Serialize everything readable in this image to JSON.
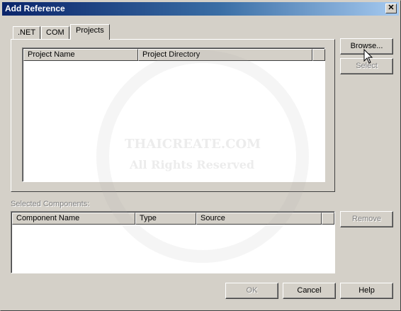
{
  "window": {
    "title": "Add Reference",
    "close_glyph": "✕"
  },
  "tabs": [
    {
      "label": ".NET"
    },
    {
      "label": "COM"
    },
    {
      "label": "Projects",
      "selected": true
    }
  ],
  "projects_list": {
    "columns": [
      "Project Name",
      "Project Directory"
    ],
    "rows": []
  },
  "side_buttons": {
    "browse": "Browse...",
    "select": "Select"
  },
  "selected_components": {
    "label": "Selected Components:",
    "columns": [
      "Component Name",
      "Type",
      "Source"
    ],
    "rows": [],
    "remove": "Remove"
  },
  "footer": {
    "ok": "OK",
    "cancel": "Cancel",
    "help": "Help"
  },
  "watermark": {
    "line1": "THAICREATE.COM",
    "line2": "All Rights Reserved"
  },
  "colors": {
    "face": "#d4d0c8",
    "title_start": "#0a246a",
    "title_end": "#a6caf0"
  }
}
